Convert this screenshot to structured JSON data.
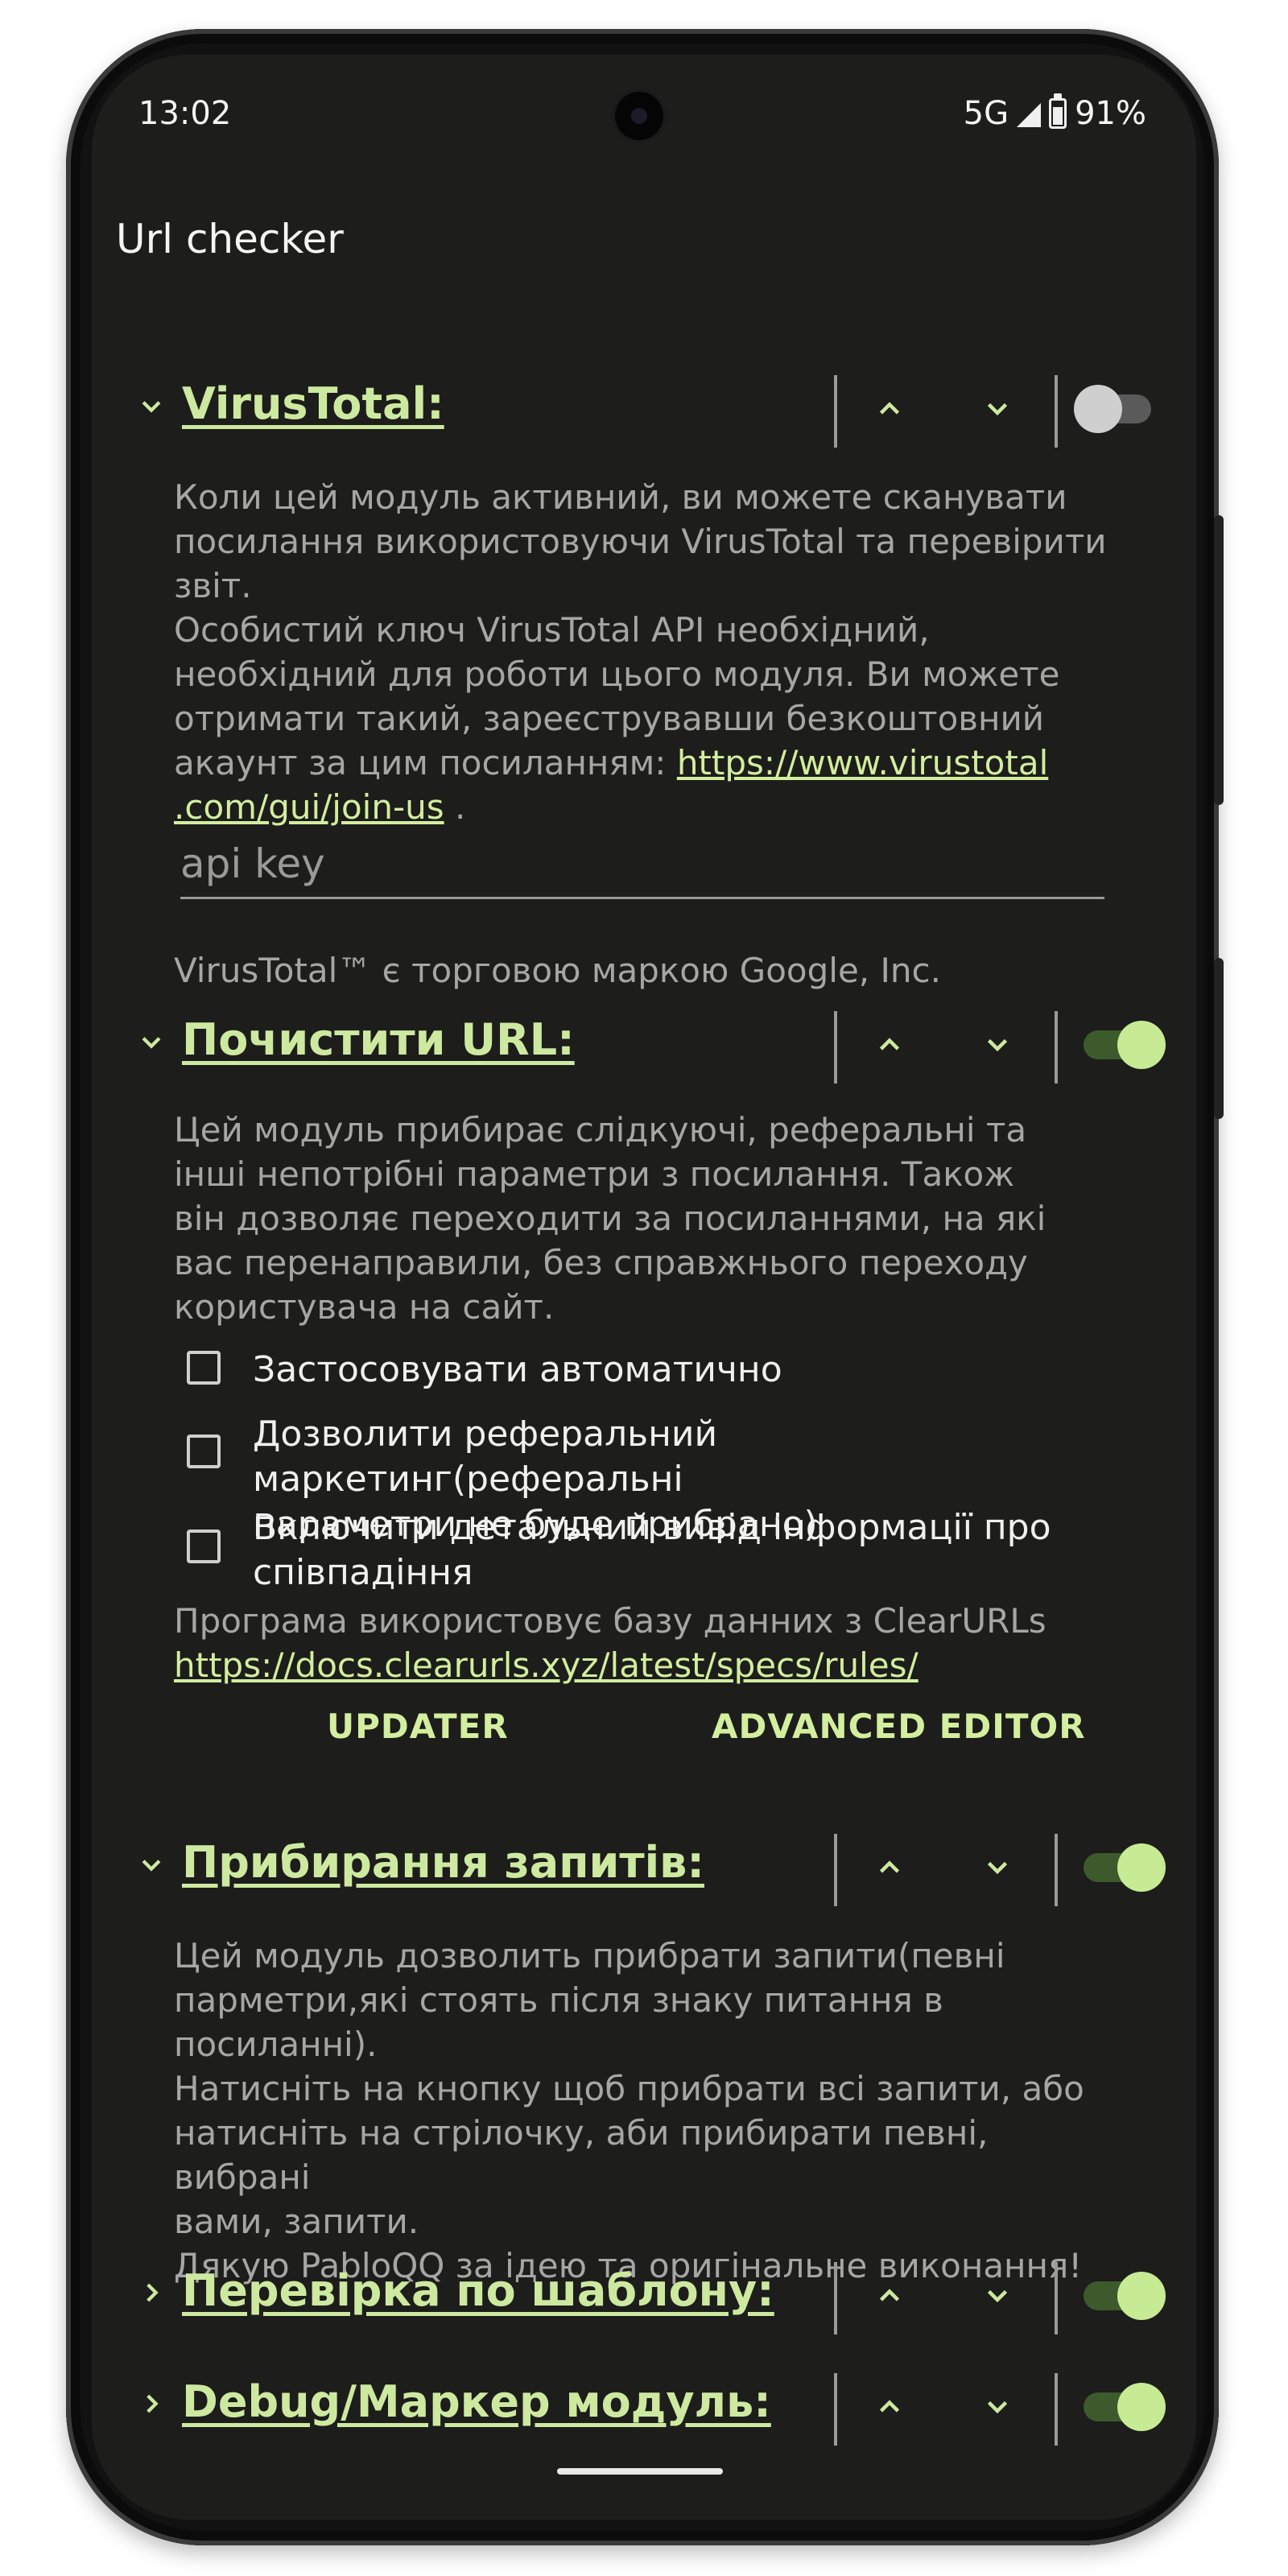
{
  "status": {
    "time": "13:02",
    "network": "5G",
    "battery": "91%"
  },
  "app": {
    "title": "Url checker"
  },
  "modules": {
    "virustotal": {
      "title": "VirusTotal:",
      "enabled": false,
      "desc_lines": [
        "Коли цей модуль активний, ви можете сканувати",
        "посилання використовуючи VirusTotal та перевірити",
        "звіт.",
        "Особистий ключ VirusTotal API необхідний,",
        "необхідний для роботи цього модуля. Ви можете",
        "отримати такий, зареєструвавши безкоштовний",
        "акаунт за цим посиланням: "
      ],
      "link_part1": "https://www.virustotal",
      "link_part2": ".com/gui/join-us",
      "link_suffix": " .",
      "api_placeholder": "api key",
      "trademark": "VirusTotal™ є торговою маркою Google, Inc."
    },
    "clean_url": {
      "title": "Почистити URL:",
      "enabled": true,
      "desc_lines": [
        "Цей модуль прибирає слідкуючі, реферальні та",
        "інші непотрібні параметри з посилання. Також",
        "він дозволяє переходити за посиланнями, на які",
        "вас перенаправили, без справжнього переходу",
        "користувача на сайт."
      ],
      "options": [
        {
          "label_lines": [
            "Застосовувати автоматично"
          ],
          "checked": false
        },
        {
          "label_lines": [
            "Дозволити реферальний маркетинг(реферальні",
            "параметри не буде прибрано)"
          ],
          "checked": false
        },
        {
          "label_lines": [
            "Включити детальний вивід інформації про",
            "співпадіння"
          ],
          "checked": false
        }
      ],
      "db_note": "Програма використовує базу данних з ClearURLs",
      "db_link": "https://docs.clearurls.xyz/latest/specs/rules/",
      "updater_label": "UPDATER",
      "advanced_label": "ADVANCED EDITOR"
    },
    "remove_queries": {
      "title": "Прибирання запитів:",
      "enabled": true,
      "desc_lines": [
        "Цей модуль дозволить прибрати запити(певні",
        "парметри,які стоять після знаку питання в",
        "посиланні).",
        "Натисніть на кнопку щоб прибрати всі запити, або",
        "натисніть на стрілочку, аби прибирати певні, вибрані",
        "вами, запити.",
        "Дякую PabloQQ за ідею та оригінальне виконання!"
      ]
    },
    "pattern_check": {
      "title": "Перевірка по шаблону:",
      "enabled": true
    },
    "debug": {
      "title": "Debug/Маркер модуль:",
      "enabled": true
    }
  }
}
